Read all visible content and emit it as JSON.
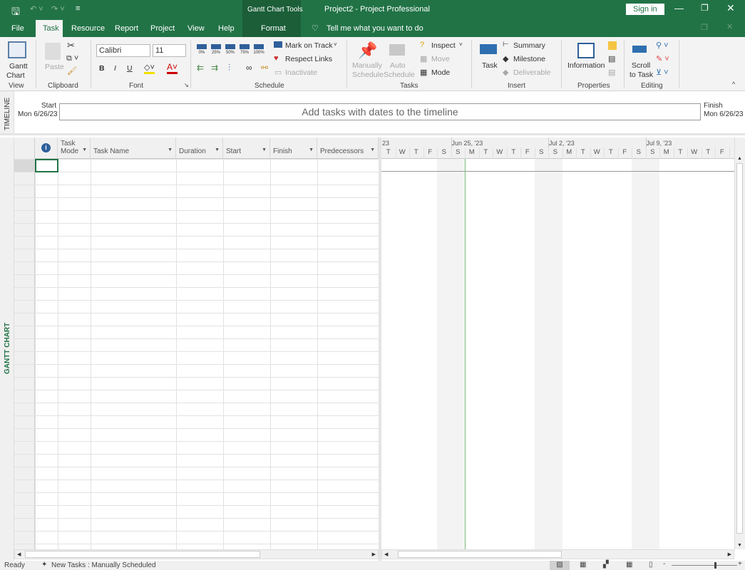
{
  "app": {
    "title": "Project2  -  Project Professional",
    "context_tab_group": "Gantt Chart Tools",
    "sign_in": "Sign in",
    "tell_me": "Tell me what you want to do"
  },
  "tabs": [
    {
      "label": "File"
    },
    {
      "label": "Task",
      "active": true
    },
    {
      "label": "Resource"
    },
    {
      "label": "Report"
    },
    {
      "label": "Project"
    },
    {
      "label": "View"
    },
    {
      "label": "Help"
    },
    {
      "label": "Format"
    }
  ],
  "ribbon": {
    "view": {
      "gantt_chart": "Gantt",
      "gantt_chart2": "Chart",
      "group": "View"
    },
    "clipboard": {
      "paste": "Paste",
      "group": "Clipboard"
    },
    "font": {
      "name": "Calibri",
      "size": "11",
      "bold": "B",
      "italic": "I",
      "underline": "U",
      "group": "Font"
    },
    "schedule": {
      "pct": [
        "0%",
        "25%",
        "50%",
        "75%",
        "100%"
      ],
      "mark_on_track": "Mark on Track",
      "respect_links": "Respect Links",
      "inactivate": "Inactivate",
      "group": "Schedule"
    },
    "tasks": {
      "manually": "Manually",
      "manually2": "Schedule",
      "auto": "Auto",
      "auto2": "Schedule",
      "inspect": "Inspect",
      "move": "Move",
      "mode": "Mode",
      "group": "Tasks"
    },
    "insert": {
      "task": "Task",
      "summary": "Summary",
      "milestone": "Milestone",
      "deliverable": "Deliverable",
      "group": "Insert"
    },
    "properties": {
      "information": "Information",
      "group": "Properties"
    },
    "editing": {
      "scroll": "Scroll",
      "scroll2": "to Task",
      "group": "Editing"
    }
  },
  "timeline": {
    "label": "TIMELINE",
    "start_label": "Start",
    "start_date": "Mon 6/26/23",
    "finish_label": "Finish",
    "finish_date": "Mon 6/26/23",
    "placeholder": "Add tasks with dates to the timeline"
  },
  "gantt": {
    "side_label": "GANTT CHART",
    "columns": [
      {
        "label": "Task\nMode",
        "top": "Task",
        "bottom": "Mode"
      },
      {
        "label": "Task Name"
      },
      {
        "label": "Duration"
      },
      {
        "label": "Start"
      },
      {
        "label": "Finish"
      },
      {
        "label": "Predecessors"
      }
    ],
    "weeks": [
      "23",
      "Jun 25, '23",
      "Jul 2, '23",
      "Jul 9, '23"
    ],
    "days": [
      "T",
      "W",
      "T",
      "F",
      "S",
      "S",
      "M",
      "T",
      "W",
      "T",
      "F",
      "S",
      "S",
      "M",
      "T",
      "W",
      "T",
      "F",
      "S",
      "S",
      "M",
      "T",
      "W",
      "T",
      "F"
    ]
  },
  "status": {
    "ready": "Ready",
    "new_tasks": "New Tasks : Manually Scheduled"
  },
  "colors": {
    "brand": "#217346",
    "context": "#1b5e38",
    "accent_line": "#7fbf7f"
  }
}
